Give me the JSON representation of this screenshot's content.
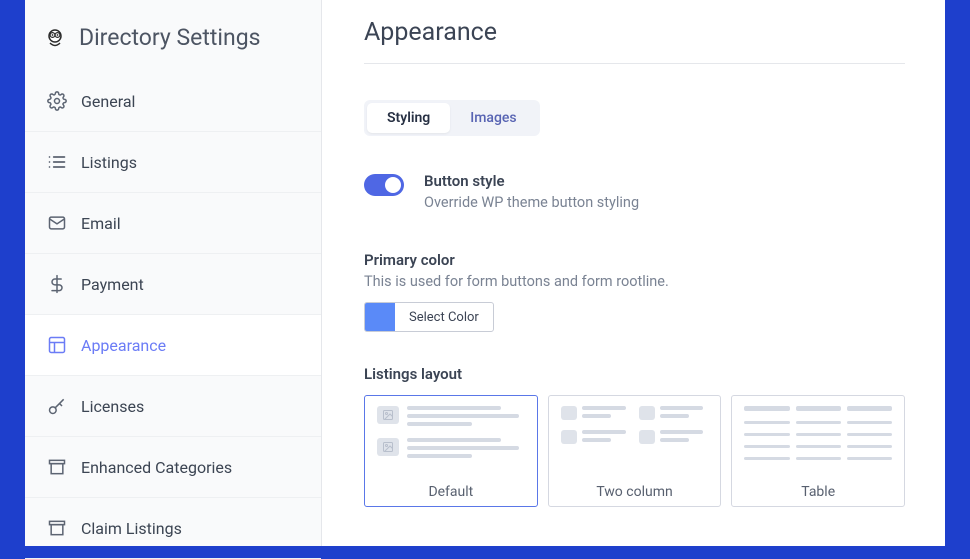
{
  "sidebar": {
    "title": "Directory Settings",
    "items": [
      {
        "label": "General"
      },
      {
        "label": "Listings"
      },
      {
        "label": "Email"
      },
      {
        "label": "Payment"
      },
      {
        "label": "Appearance"
      },
      {
        "label": "Licenses"
      },
      {
        "label": "Enhanced Categories"
      },
      {
        "label": "Claim Listings"
      }
    ]
  },
  "page": {
    "title": "Appearance"
  },
  "tabs": {
    "styling": "Styling",
    "images": "Images"
  },
  "buttonStyle": {
    "label": "Button style",
    "desc": "Override WP theme button styling"
  },
  "primaryColor": {
    "title": "Primary color",
    "desc": "This is used for form buttons and form rootline.",
    "button": "Select Color",
    "value": "#5a8af8"
  },
  "listingsLayout": {
    "title": "Listings layout",
    "options": {
      "default": "Default",
      "two": "Two column",
      "table": "Table"
    }
  }
}
